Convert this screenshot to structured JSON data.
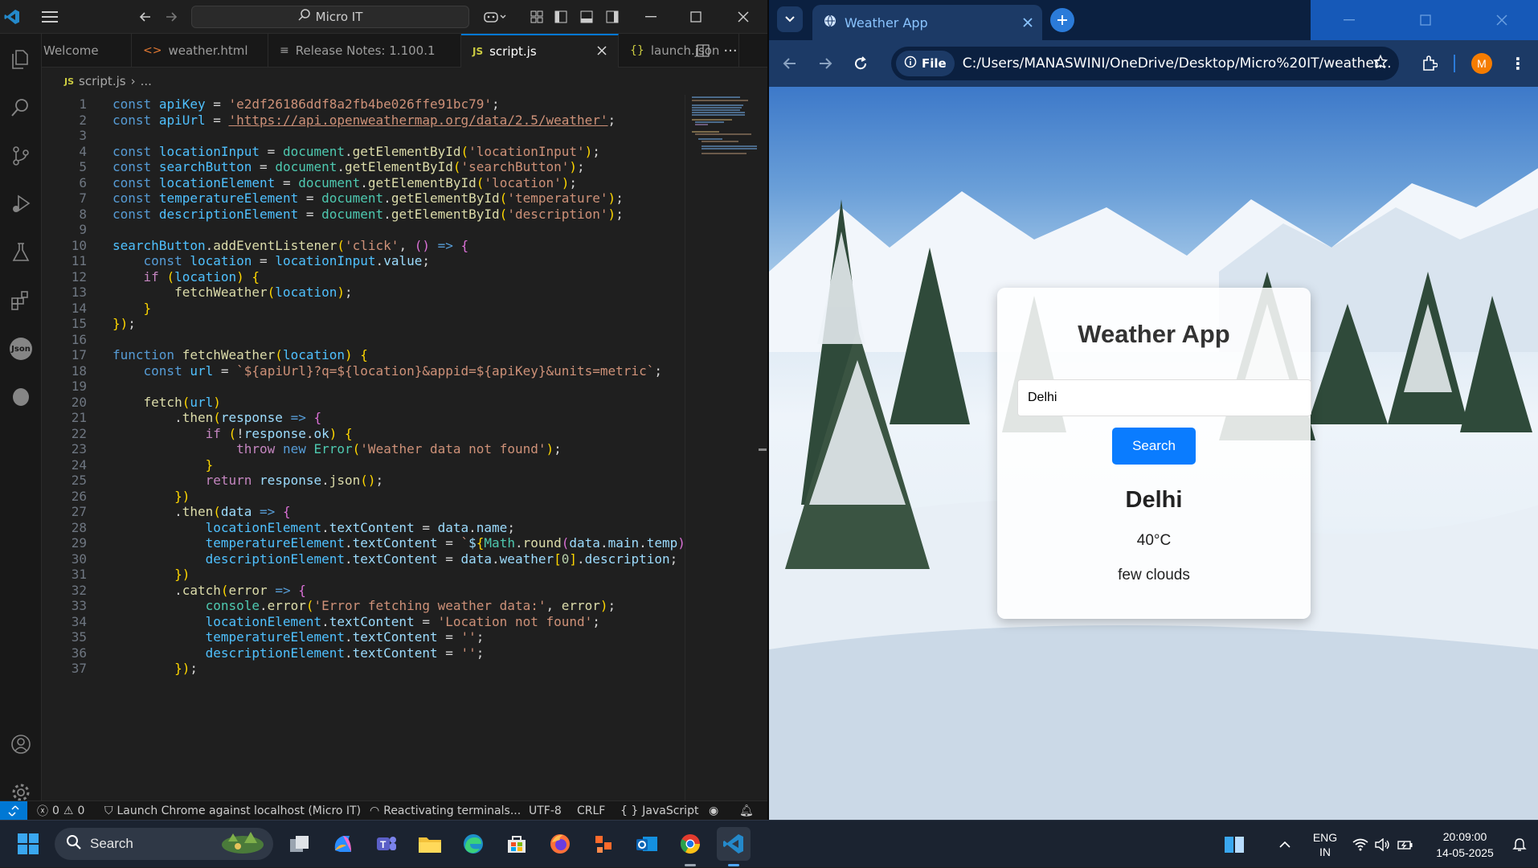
{
  "vscode": {
    "title": "Micro IT",
    "tabs": [
      {
        "label": "Welcome",
        "icon": "vscode-icon"
      },
      {
        "label": "weather.html",
        "icon": "html-icon"
      },
      {
        "label": "Release Notes: 1.100.1",
        "icon": "notes-icon"
      },
      {
        "label": "script.js",
        "icon": "js-icon",
        "active": true
      },
      {
        "label": "launch.json",
        "icon": "json-icon"
      }
    ],
    "breadcrumb": {
      "file": "script.js",
      "more": "..."
    },
    "code": [
      {
        "n": "1",
        "t": "const apiKey = 'e2df26186ddf8a2fb4be026ffe91bc79';"
      },
      {
        "n": "2",
        "t": "const apiUrl = 'https://api.openweathermap.org/data/2.5/weather';"
      },
      {
        "n": "3",
        "t": ""
      },
      {
        "n": "4",
        "t": "const locationInput = document.getElementById('locationInput');"
      },
      {
        "n": "5",
        "t": "const searchButton = document.getElementById('searchButton');"
      },
      {
        "n": "6",
        "t": "const locationElement = document.getElementById('location');"
      },
      {
        "n": "7",
        "t": "const temperatureElement = document.getElementById('temperature');"
      },
      {
        "n": "8",
        "t": "const descriptionElement = document.getElementById('description');"
      },
      {
        "n": "9",
        "t": ""
      },
      {
        "n": "10",
        "t": "searchButton.addEventListener('click', () => {"
      },
      {
        "n": "11",
        "t": "    const location = locationInput.value;"
      },
      {
        "n": "12",
        "t": "    if (location) {"
      },
      {
        "n": "13",
        "t": "        fetchWeather(location);"
      },
      {
        "n": "14",
        "t": "    }"
      },
      {
        "n": "15",
        "t": "});"
      },
      {
        "n": "16",
        "t": ""
      },
      {
        "n": "17",
        "t": "function fetchWeather(location) {"
      },
      {
        "n": "18",
        "t": "    const url = `${apiUrl}?q=${location}&appid=${apiKey}&units=metric`;"
      },
      {
        "n": "19",
        "t": ""
      },
      {
        "n": "20",
        "t": "    fetch(url)"
      },
      {
        "n": "21",
        "t": "        .then(response => {"
      },
      {
        "n": "22",
        "t": "            if (!response.ok) {"
      },
      {
        "n": "23",
        "t": "                throw new Error('Weather data not found');"
      },
      {
        "n": "24",
        "t": "            }"
      },
      {
        "n": "25",
        "t": "            return response.json();"
      },
      {
        "n": "26",
        "t": "        })"
      },
      {
        "n": "27",
        "t": "        .then(data => {"
      },
      {
        "n": "28",
        "t": "            locationElement.textContent = data.name;"
      },
      {
        "n": "29",
        "t": "            temperatureElement.textContent = `${Math.round(data.main.temp)"
      },
      {
        "n": "30",
        "t": "            descriptionElement.textContent = data.weather[0].description;"
      },
      {
        "n": "31",
        "t": "        })"
      },
      {
        "n": "32",
        "t": "        .catch(error => {"
      },
      {
        "n": "33",
        "t": "            console.error('Error fetching weather data:', error);"
      },
      {
        "n": "34",
        "t": "            locationElement.textContent = 'Location not found';"
      },
      {
        "n": "35",
        "t": "            temperatureElement.textContent = '';"
      },
      {
        "n": "36",
        "t": "            descriptionElement.textContent = '';"
      },
      {
        "n": "37",
        "t": "        });"
      }
    ],
    "status": {
      "problems": "0",
      "warnings": "0",
      "debug": "Launch Chrome against localhost (Micro IT)",
      "task": "Reactivating terminals...",
      "encoding": "UTF-8",
      "eol": "CRLF",
      "language": "JavaScript"
    }
  },
  "browser": {
    "tab_title": "Weather App",
    "file_chip": "File",
    "address": "C:/Users/MANASWINI/OneDrive/Desktop/Micro%20IT/weather...",
    "profile_initial": "M",
    "page": {
      "heading": "Weather App",
      "input_value": "Delhi",
      "button_label": "Search",
      "location": "Delhi",
      "temperature": "40°C",
      "description": "few clouds"
    }
  },
  "taskbar": {
    "search_label": "Search",
    "lang_top": "ENG",
    "lang_bottom": "IN",
    "time": "20:09:00",
    "date": "14-05-2025"
  }
}
